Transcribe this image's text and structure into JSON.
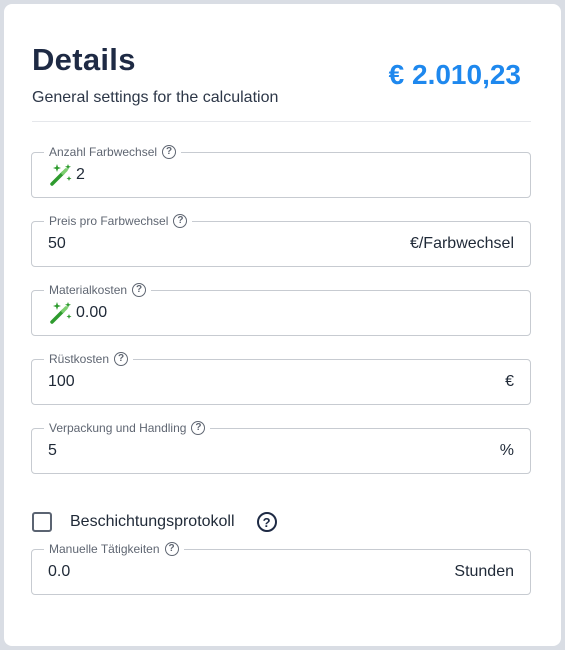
{
  "header": {
    "title": "Details",
    "subtitle": "General settings for the calculation",
    "total": "€ 2.010,23"
  },
  "fields": [
    {
      "label": "Anzahl Farbwechsel",
      "value": "2",
      "unit": "",
      "icon": "magic-wand-icon"
    },
    {
      "label": "Preis pro Farbwechsel",
      "value": "50",
      "unit": "€/Farbwechsel"
    },
    {
      "label": "Materialkosten",
      "value": "0.00",
      "unit": "",
      "icon": "magic-wand-icon"
    },
    {
      "label": "Rüstkosten",
      "value": "100",
      "unit": "€"
    },
    {
      "label": "Verpackung und Handling",
      "value": "5",
      "unit": "%"
    }
  ],
  "checkbox": {
    "label": "Beschichtungsprotokoll",
    "checked": false
  },
  "manual": {
    "label": "Manuelle Tätigkeiten",
    "value": "0.0",
    "unit": "Stunden"
  },
  "help_glyph": "?",
  "colors": {
    "accent": "#1e88ee",
    "title": "#1e2a44",
    "wand": "#2e9b2e"
  }
}
